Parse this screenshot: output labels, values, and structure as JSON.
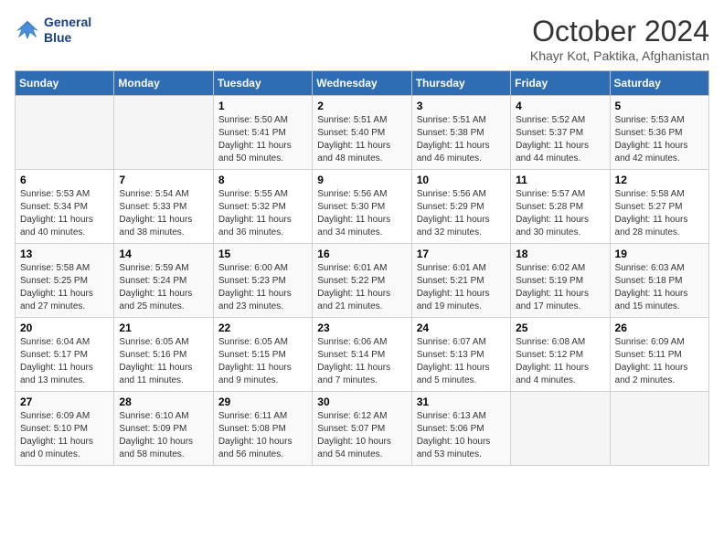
{
  "logo": {
    "line1": "General",
    "line2": "Blue"
  },
  "title": "October 2024",
  "location": "Khayr Kot, Paktika, Afghanistan",
  "days_of_week": [
    "Sunday",
    "Monday",
    "Tuesday",
    "Wednesday",
    "Thursday",
    "Friday",
    "Saturday"
  ],
  "weeks": [
    [
      {
        "day": "",
        "sunrise": "",
        "sunset": "",
        "daylight": ""
      },
      {
        "day": "",
        "sunrise": "",
        "sunset": "",
        "daylight": ""
      },
      {
        "day": "1",
        "sunrise": "Sunrise: 5:50 AM",
        "sunset": "Sunset: 5:41 PM",
        "daylight": "Daylight: 11 hours and 50 minutes."
      },
      {
        "day": "2",
        "sunrise": "Sunrise: 5:51 AM",
        "sunset": "Sunset: 5:40 PM",
        "daylight": "Daylight: 11 hours and 48 minutes."
      },
      {
        "day": "3",
        "sunrise": "Sunrise: 5:51 AM",
        "sunset": "Sunset: 5:38 PM",
        "daylight": "Daylight: 11 hours and 46 minutes."
      },
      {
        "day": "4",
        "sunrise": "Sunrise: 5:52 AM",
        "sunset": "Sunset: 5:37 PM",
        "daylight": "Daylight: 11 hours and 44 minutes."
      },
      {
        "day": "5",
        "sunrise": "Sunrise: 5:53 AM",
        "sunset": "Sunset: 5:36 PM",
        "daylight": "Daylight: 11 hours and 42 minutes."
      }
    ],
    [
      {
        "day": "6",
        "sunrise": "Sunrise: 5:53 AM",
        "sunset": "Sunset: 5:34 PM",
        "daylight": "Daylight: 11 hours and 40 minutes."
      },
      {
        "day": "7",
        "sunrise": "Sunrise: 5:54 AM",
        "sunset": "Sunset: 5:33 PM",
        "daylight": "Daylight: 11 hours and 38 minutes."
      },
      {
        "day": "8",
        "sunrise": "Sunrise: 5:55 AM",
        "sunset": "Sunset: 5:32 PM",
        "daylight": "Daylight: 11 hours and 36 minutes."
      },
      {
        "day": "9",
        "sunrise": "Sunrise: 5:56 AM",
        "sunset": "Sunset: 5:30 PM",
        "daylight": "Daylight: 11 hours and 34 minutes."
      },
      {
        "day": "10",
        "sunrise": "Sunrise: 5:56 AM",
        "sunset": "Sunset: 5:29 PM",
        "daylight": "Daylight: 11 hours and 32 minutes."
      },
      {
        "day": "11",
        "sunrise": "Sunrise: 5:57 AM",
        "sunset": "Sunset: 5:28 PM",
        "daylight": "Daylight: 11 hours and 30 minutes."
      },
      {
        "day": "12",
        "sunrise": "Sunrise: 5:58 AM",
        "sunset": "Sunset: 5:27 PM",
        "daylight": "Daylight: 11 hours and 28 minutes."
      }
    ],
    [
      {
        "day": "13",
        "sunrise": "Sunrise: 5:58 AM",
        "sunset": "Sunset: 5:25 PM",
        "daylight": "Daylight: 11 hours and 27 minutes."
      },
      {
        "day": "14",
        "sunrise": "Sunrise: 5:59 AM",
        "sunset": "Sunset: 5:24 PM",
        "daylight": "Daylight: 11 hours and 25 minutes."
      },
      {
        "day": "15",
        "sunrise": "Sunrise: 6:00 AM",
        "sunset": "Sunset: 5:23 PM",
        "daylight": "Daylight: 11 hours and 23 minutes."
      },
      {
        "day": "16",
        "sunrise": "Sunrise: 6:01 AM",
        "sunset": "Sunset: 5:22 PM",
        "daylight": "Daylight: 11 hours and 21 minutes."
      },
      {
        "day": "17",
        "sunrise": "Sunrise: 6:01 AM",
        "sunset": "Sunset: 5:21 PM",
        "daylight": "Daylight: 11 hours and 19 minutes."
      },
      {
        "day": "18",
        "sunrise": "Sunrise: 6:02 AM",
        "sunset": "Sunset: 5:19 PM",
        "daylight": "Daylight: 11 hours and 17 minutes."
      },
      {
        "day": "19",
        "sunrise": "Sunrise: 6:03 AM",
        "sunset": "Sunset: 5:18 PM",
        "daylight": "Daylight: 11 hours and 15 minutes."
      }
    ],
    [
      {
        "day": "20",
        "sunrise": "Sunrise: 6:04 AM",
        "sunset": "Sunset: 5:17 PM",
        "daylight": "Daylight: 11 hours and 13 minutes."
      },
      {
        "day": "21",
        "sunrise": "Sunrise: 6:05 AM",
        "sunset": "Sunset: 5:16 PM",
        "daylight": "Daylight: 11 hours and 11 minutes."
      },
      {
        "day": "22",
        "sunrise": "Sunrise: 6:05 AM",
        "sunset": "Sunset: 5:15 PM",
        "daylight": "Daylight: 11 hours and 9 minutes."
      },
      {
        "day": "23",
        "sunrise": "Sunrise: 6:06 AM",
        "sunset": "Sunset: 5:14 PM",
        "daylight": "Daylight: 11 hours and 7 minutes."
      },
      {
        "day": "24",
        "sunrise": "Sunrise: 6:07 AM",
        "sunset": "Sunset: 5:13 PM",
        "daylight": "Daylight: 11 hours and 5 minutes."
      },
      {
        "day": "25",
        "sunrise": "Sunrise: 6:08 AM",
        "sunset": "Sunset: 5:12 PM",
        "daylight": "Daylight: 11 hours and 4 minutes."
      },
      {
        "day": "26",
        "sunrise": "Sunrise: 6:09 AM",
        "sunset": "Sunset: 5:11 PM",
        "daylight": "Daylight: 11 hours and 2 minutes."
      }
    ],
    [
      {
        "day": "27",
        "sunrise": "Sunrise: 6:09 AM",
        "sunset": "Sunset: 5:10 PM",
        "daylight": "Daylight: 11 hours and 0 minutes."
      },
      {
        "day": "28",
        "sunrise": "Sunrise: 6:10 AM",
        "sunset": "Sunset: 5:09 PM",
        "daylight": "Daylight: 10 hours and 58 minutes."
      },
      {
        "day": "29",
        "sunrise": "Sunrise: 6:11 AM",
        "sunset": "Sunset: 5:08 PM",
        "daylight": "Daylight: 10 hours and 56 minutes."
      },
      {
        "day": "30",
        "sunrise": "Sunrise: 6:12 AM",
        "sunset": "Sunset: 5:07 PM",
        "daylight": "Daylight: 10 hours and 54 minutes."
      },
      {
        "day": "31",
        "sunrise": "Sunrise: 6:13 AM",
        "sunset": "Sunset: 5:06 PM",
        "daylight": "Daylight: 10 hours and 53 minutes."
      },
      {
        "day": "",
        "sunrise": "",
        "sunset": "",
        "daylight": ""
      },
      {
        "day": "",
        "sunrise": "",
        "sunset": "",
        "daylight": ""
      }
    ]
  ]
}
